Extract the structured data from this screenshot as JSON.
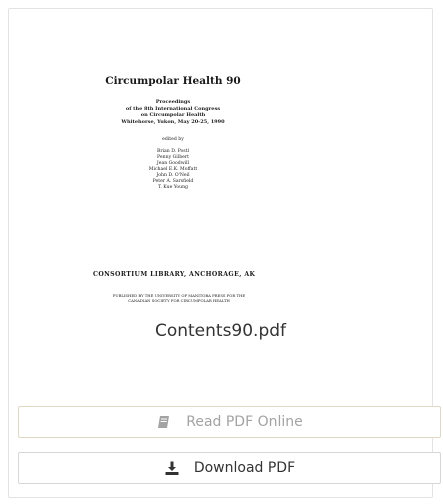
{
  "document_preview": {
    "title": "Circumpolar Health 90",
    "proceedings_lines": [
      "Proceedings",
      "of the 8th International Congress",
      "on Circumpolar Health",
      "Whitehorse, Yukon, May 20-25, 1990"
    ],
    "edited_by": "edited by",
    "editors": [
      "Brian D. Postl",
      "Penny Gilbert",
      "Jean Goodwill",
      "Michael E.K. Moffatt",
      "John D. O'Neil",
      "Peter A. Sarsfield",
      "T. Kue Young"
    ],
    "publisher": "CONSORTIUM LIBRARY, ANCHORAGE, AK",
    "publisher_note_lines": [
      "PUBLISHED BY THE UNIVERSITY OF MANITOBA PRESS FOR THE",
      "CANADIAN SOCIETY FOR CIRCUMPOLAR HEALTH"
    ]
  },
  "file": {
    "name": "Contents90.pdf"
  },
  "actions": {
    "read_label": "Read PDF Online",
    "download_label": "Download PDF"
  },
  "icons": {
    "read": "book-icon",
    "download": "download-icon"
  },
  "colors": {
    "read_text": "#a3a3a3",
    "download_text": "#333333",
    "read_border": "#dfd9c3"
  }
}
